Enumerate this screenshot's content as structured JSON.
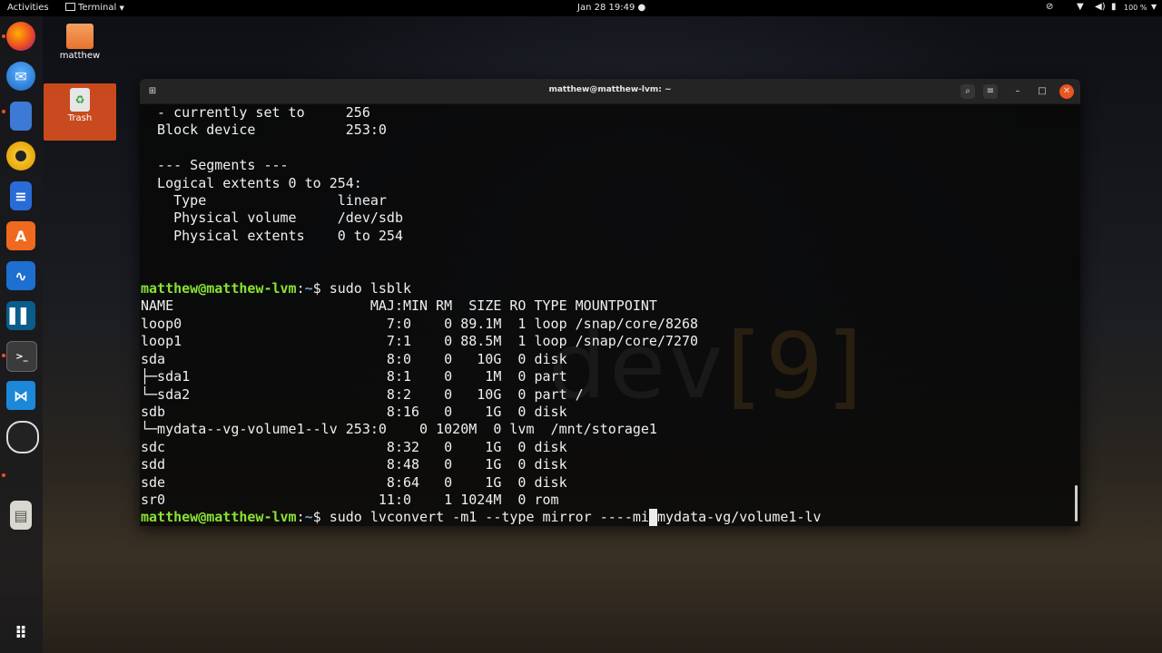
{
  "topbar": {
    "activities": "Activities",
    "app_menu": "Terminal",
    "clock": "Jan 28  19:49",
    "battery": "100 %"
  },
  "desktop": {
    "home_label": "matthew",
    "trash_label": "Trash"
  },
  "dock": {
    "apps": [
      "firefox-icon",
      "thunderbird-icon",
      "files-icon",
      "rhythmbox-icon",
      "libreoffice-writer-icon",
      "software-center-icon",
      "system-monitor-icon",
      "bookshelf-icon",
      "terminal-icon",
      "vscode-icon",
      "obs-icon",
      "files-cabinet-icon",
      "app-grid-icon"
    ]
  },
  "terminal": {
    "title": "matthew@matthew-lvm: ~",
    "prompt_user": "matthew@matthew-lvm",
    "prompt_path": "~",
    "prompt_sep": ":",
    "prompt_dollar": "$ ",
    "output_top": [
      "  - currently set to     256",
      "  Block device           253:0",
      "",
      "  --- Segments ---",
      "  Logical extents 0 to 254:",
      "    Type                linear",
      "    Physical volume     /dev/sdb",
      "    Physical extents    0 to 254",
      "",
      ""
    ],
    "cmd1": "sudo lsblk",
    "lsblk": [
      "NAME                        MAJ:MIN RM  SIZE RO TYPE MOUNTPOINT",
      "loop0                         7:0    0 89.1M  1 loop /snap/core/8268",
      "loop1                         7:1    0 88.5M  1 loop /snap/core/7270",
      "sda                           8:0    0   10G  0 disk",
      "├─sda1                        8:1    0    1M  0 part",
      "└─sda2                        8:2    0   10G  0 part /",
      "sdb                           8:16   0    1G  0 disk",
      "└─mydata--vg-volume1--lv 253:0    0 1020M  0 lvm  /mnt/storage1",
      "sdc                           8:32   0    1G  0 disk",
      "sdd                           8:48   0    1G  0 disk",
      "sde                           8:64   0    1G  0 disk",
      "sr0                          11:0    1 1024M  0 rom"
    ],
    "cmd2_before": "sudo lvconvert -m1 --type mirror ----mi",
    "cmd2_cursor": " ",
    "cmd2_after": "mydata-vg/volume1-lv",
    "watermark_a": "dev",
    "watermark_b": "[9]"
  }
}
